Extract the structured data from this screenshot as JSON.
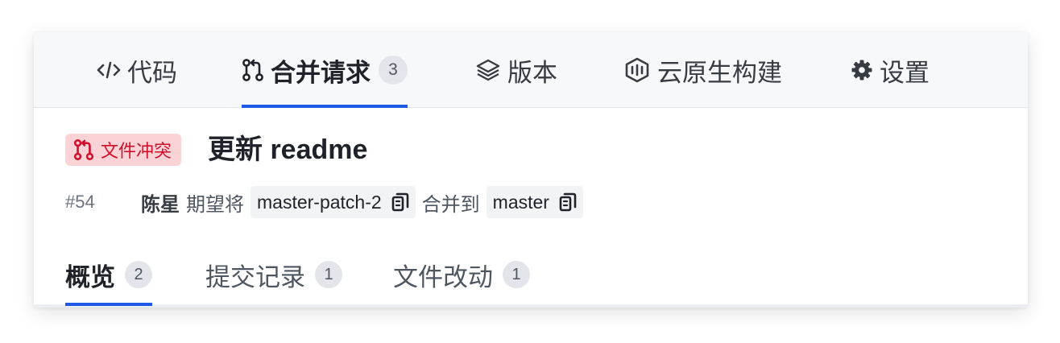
{
  "nav": {
    "tabs": [
      {
        "label": "代码",
        "icon": "code-icon"
      },
      {
        "label": "合并请求",
        "icon": "merge-request-icon",
        "count": "3",
        "active": true
      },
      {
        "label": "版本",
        "icon": "layers-icon"
      },
      {
        "label": "云原生构建",
        "icon": "cloud-build-icon"
      },
      {
        "label": "设置",
        "icon": "gear-icon"
      }
    ]
  },
  "merge_request": {
    "status_badge": "文件冲突",
    "title": "更新 readme",
    "id": "#54",
    "author": "陈星",
    "expect_text": "期望将",
    "source_branch": "master-patch-2",
    "merge_into_text": "合并到",
    "target_branch": "master"
  },
  "subtabs": [
    {
      "label": "概览",
      "count": "2",
      "active": true
    },
    {
      "label": "提交记录",
      "count": "1"
    },
    {
      "label": "文件改动",
      "count": "1"
    }
  ],
  "colors": {
    "accent": "#1e5ae6",
    "conflict_bg": "#fbd3d6",
    "conflict_text": "#d0102b"
  }
}
